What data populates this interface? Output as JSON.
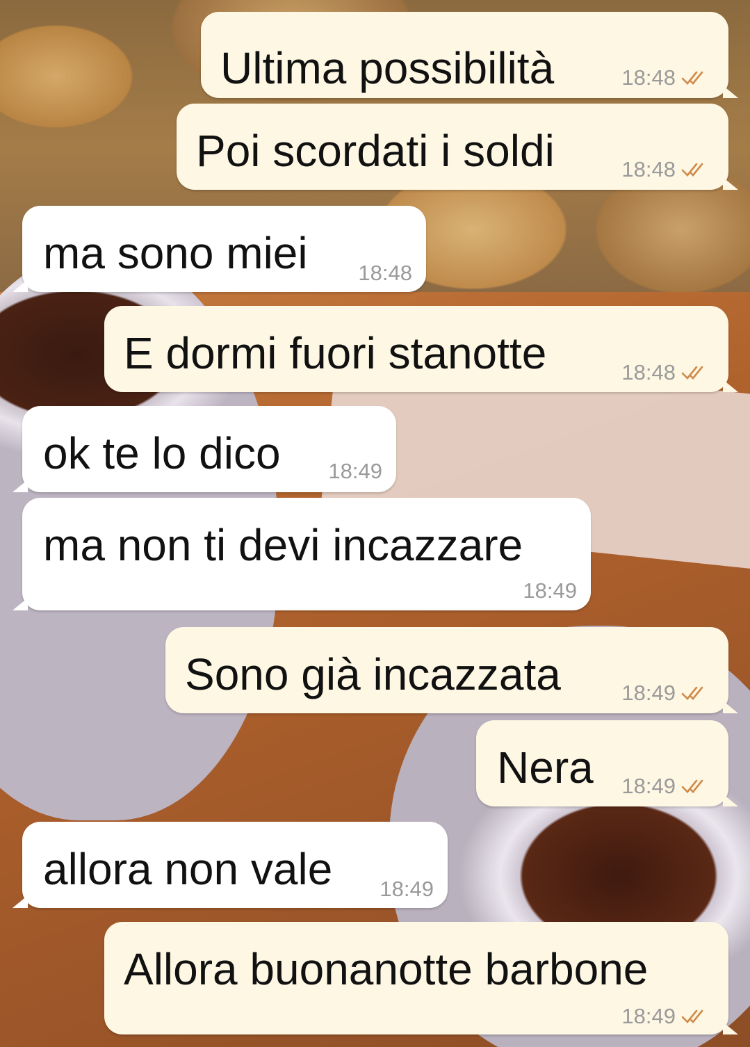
{
  "messages": [
    {
      "direction": "out",
      "text": "Ultima possibilità",
      "time": "18:48",
      "status_icon": "double-check-read-icon"
    },
    {
      "direction": "out",
      "text": "Poi scordati i soldi",
      "time": "18:48",
      "status_icon": "double-check-read-icon"
    },
    {
      "direction": "in",
      "text": "ma sono miei",
      "time": "18:48"
    },
    {
      "direction": "out",
      "text": "E dormi fuori stanotte",
      "time": "18:48",
      "status_icon": "double-check-read-icon"
    },
    {
      "direction": "in",
      "text": "ok te lo dico",
      "time": "18:49"
    },
    {
      "direction": "in",
      "text": "ma non ti devi incazzare",
      "time": "18:49"
    },
    {
      "direction": "out",
      "text": "Sono già incazzata",
      "time": "18:49",
      "status_icon": "double-check-read-icon"
    },
    {
      "direction": "out",
      "text": "Nera",
      "time": "18:49",
      "status_icon": "double-check-read-icon"
    },
    {
      "direction": "in",
      "text": "allora non vale",
      "time": "18:49"
    },
    {
      "direction": "out",
      "text": "Allora buonanotte barbone",
      "time": "18:49",
      "status_icon": "double-check-read-icon"
    }
  ],
  "colors": {
    "outgoing_bubble": "#fdf7e3",
    "incoming_bubble": "#ffffff",
    "timestamp": "#9a9a9a",
    "read_ticks": "#d08a4a"
  }
}
